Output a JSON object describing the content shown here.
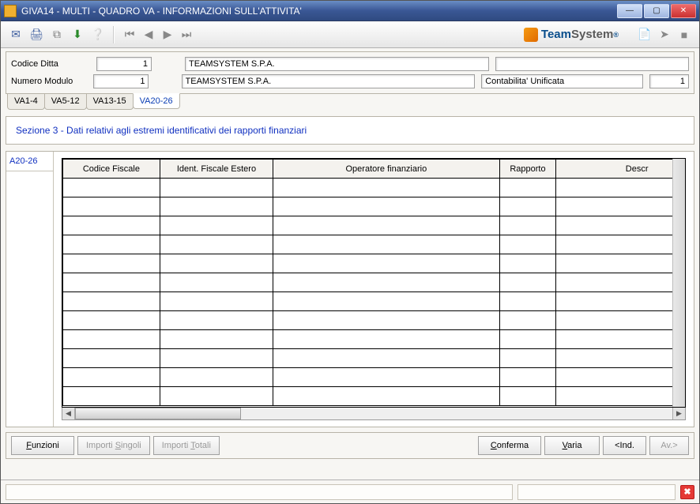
{
  "window": {
    "title": "GIVA14  - MULTI -  QUADRO VA - INFORMAZIONI SULL'ATTIVITA'"
  },
  "brand": {
    "team": "Team",
    "system": "System",
    "reg": "®"
  },
  "fields": {
    "codice_ditta_label": "Codice Ditta",
    "codice_ditta_value": "1",
    "numero_modulo_label": "Numero Modulo",
    "numero_modulo_value": "1",
    "company1": "TEAMSYSTEM S.P.A.",
    "company2": "TEAMSYSTEM S.P.A.",
    "contab_label": "Contabilita' Unificata",
    "contab_value": "1"
  },
  "tabs": {
    "t1": "VA1-4",
    "t2": "VA5-12",
    "t3": "VA13-15",
    "t4": "VA20-26"
  },
  "section": {
    "title": "Sezione 3 - Dati relativi agli estremi identificativi dei rapporti finanziari"
  },
  "side_tab": "A20-26",
  "grid": {
    "headers": {
      "h1": "Codice Fiscale",
      "h2": "Ident. Fiscale Estero",
      "h3": "Operatore finanziario",
      "h4": "Rapporto",
      "h5": "Descr"
    }
  },
  "buttons": {
    "funzioni": "Funzioni",
    "importi_singoli": "Importi Singoli",
    "importi_totali": "Importi Totali",
    "conferma": "Conferma",
    "varia": "Varia",
    "ind": "<Ind.",
    "av": "Av.>"
  }
}
